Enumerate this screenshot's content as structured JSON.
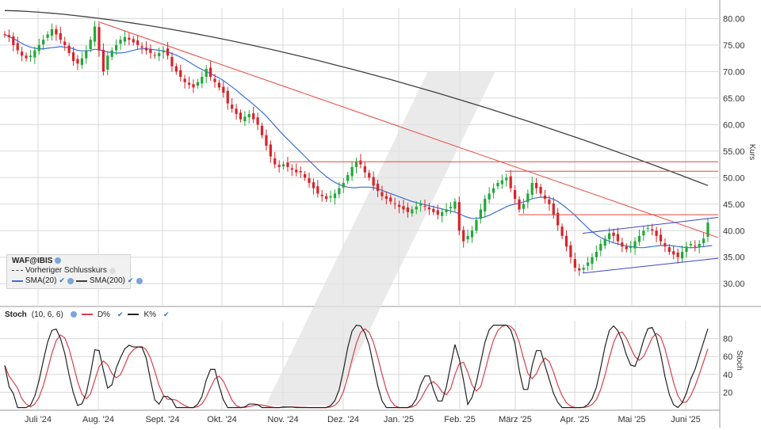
{
  "chart_data": [
    {
      "type": "candlestick",
      "title": "WAF@IBIS",
      "ylabel": "Kurs",
      "ylim": [
        26,
        82
      ],
      "yticks": [
        "30.00",
        "35.00",
        "40.00",
        "45.00",
        "50.00",
        "55.00",
        "60.00",
        "65.00",
        "70.00",
        "75.00",
        "80.00"
      ],
      "xticks": [
        "Juli '24",
        "Aug. '24",
        "Sept. '24",
        "Okt. '24",
        "Nov. '24",
        "Dez. '24",
        "Jan. '25",
        "Feb. '25",
        "März '25",
        "Apr. '25",
        "Mai '25",
        "Juni '25"
      ],
      "legend": [
        "Vorheriger Schlusskurs",
        "SMA(20)",
        "SMA(200)"
      ],
      "close": [
        77,
        76.5,
        75,
        74,
        73,
        72.5,
        73,
        74,
        75,
        76,
        77,
        78,
        77,
        76,
        75,
        73.5,
        72,
        71.5,
        72.5,
        74,
        76,
        78.5,
        74,
        70,
        73,
        74,
        75,
        76,
        76.5,
        76,
        75.5,
        75,
        74.5,
        74,
        73.5,
        73,
        73.5,
        74,
        73,
        71,
        70,
        69,
        68,
        67.5,
        67,
        68,
        69,
        70.5,
        69,
        68,
        67,
        66,
        64,
        63,
        62,
        61,
        61.5,
        62,
        61,
        60,
        58,
        56,
        54,
        52.5,
        52,
        52.5,
        52,
        51.5,
        51,
        51,
        50,
        49,
        48,
        47,
        46.5,
        46,
        46.5,
        47,
        48,
        49,
        50.5,
        52,
        53,
        52.5,
        51,
        50,
        48.5,
        47.5,
        46.5,
        46,
        45.5,
        45,
        44.5,
        44,
        43.5,
        44,
        44.5,
        45,
        44.5,
        44,
        43.5,
        43,
        43.5,
        44,
        44.5,
        45.5,
        40,
        38,
        39,
        40,
        42,
        44,
        46,
        47,
        48,
        49,
        49.5,
        50,
        48,
        46,
        44,
        45,
        47,
        49,
        48,
        47,
        46,
        45,
        43,
        41,
        39,
        37,
        35,
        33,
        32.5,
        33,
        34,
        35,
        36,
        37.5,
        38.5,
        39.5,
        39,
        38,
        37,
        36.5,
        37,
        38,
        39,
        40,
        40.5,
        40,
        39,
        38,
        37,
        36,
        35.5,
        35,
        36,
        37,
        37.5,
        37,
        37.5,
        38.5,
        41.5
      ],
      "sma20": [
        77,
        76.6,
        76.2,
        75.8,
        75.3,
        74.9,
        74.6,
        74.4,
        74.3,
        74.3,
        74.4,
        74.5,
        74.6,
        74.7,
        74.6,
        74.5,
        74.3,
        74,
        73.9,
        73.9,
        74,
        74.2,
        74.1,
        73.9,
        73.7,
        73.6,
        73.5,
        73.5,
        73.6,
        73.8,
        74,
        74.2,
        74.3,
        74.3,
        74.2,
        74.1,
        74,
        73.9,
        73.7,
        73.4,
        73.1,
        72.7,
        72.3,
        71.8,
        71.3,
        70.8,
        70.4,
        70,
        69.6,
        69.2,
        68.8,
        68.3,
        67.7,
        67.1,
        66.5,
        65.8,
        65.1,
        64.5,
        63.8,
        63.1,
        62.4,
        61.6,
        60.7,
        59.8,
        58.9,
        58,
        57.2,
        56.4,
        55.6,
        54.8,
        54,
        53.2,
        52.4,
        51.6,
        50.9,
        50.2,
        49.6,
        49.1,
        48.7,
        48.4,
        48.2,
        48.1,
        48.1,
        48.2,
        48.2,
        48.2,
        48.1,
        47.9,
        47.6,
        47.3,
        47,
        46.7,
        46.4,
        46.1,
        45.8,
        45.5,
        45.3,
        45.1,
        44.9,
        44.7,
        44.5,
        44.3,
        44.1,
        43.9,
        43.7,
        43.5,
        43.2,
        42.8,
        42.5,
        42.3,
        42.3,
        42.4,
        42.6,
        42.9,
        43.3,
        43.7,
        44.1,
        44.5,
        44.8,
        45,
        45.2,
        45.4,
        45.7,
        46,
        46.2,
        46.3,
        46.3,
        46.2,
        45.9,
        45.5,
        44.9,
        44.3,
        43.6,
        42.9,
        42.1,
        41.3,
        40.5,
        39.8,
        39.2,
        38.7,
        38.3,
        38,
        37.7,
        37.5,
        37.3,
        37.1,
        37,
        36.9,
        36.8,
        36.8,
        36.9,
        37,
        37.1,
        37.2,
        37.2,
        37.2,
        37.1,
        37,
        36.9,
        36.8,
        36.8,
        36.8,
        36.9,
        37,
        37.1,
        37.2
      ]
    },
    {
      "type": "line",
      "title": "Stoch",
      "params": "(10, 6, 6)",
      "ylabel": "Stoch",
      "ylim": [
        0,
        100
      ],
      "yticks": [
        "20",
        "40",
        "60",
        "80"
      ],
      "series_names": [
        "D%",
        "K%"
      ]
    }
  ],
  "colors": {
    "up": "#22a838",
    "down": "#d7242a",
    "sma20": "#3a6fd8",
    "sma200": "#404040",
    "trend": "#e8463c",
    "channel": "#3a46c8",
    "d": "#d64050",
    "k": "#222222",
    "grid": "#d8d8d8"
  },
  "legend_icons": [
    "eye-icon",
    "check-icon",
    "settings-icon"
  ]
}
